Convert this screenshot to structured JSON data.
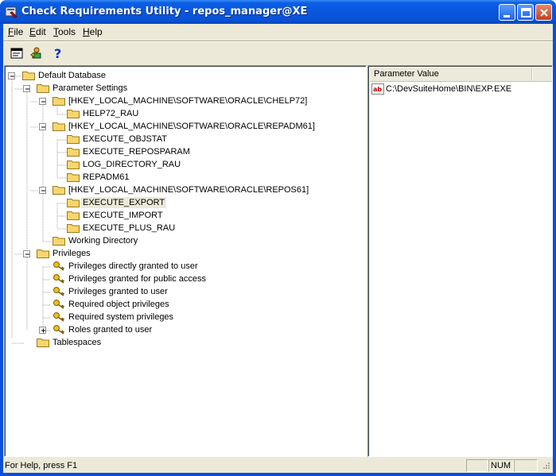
{
  "window": {
    "title": "Check Requirements Utility - repos_manager@XE"
  },
  "menu": {
    "items": [
      {
        "label": "File",
        "key": "F"
      },
      {
        "label": "Edit",
        "key": "E"
      },
      {
        "label": "Tools",
        "key": "T"
      },
      {
        "label": "Help",
        "key": "H"
      }
    ]
  },
  "toolbar": {
    "icons": [
      "properties-icon",
      "connect-icon",
      "help-icon"
    ]
  },
  "tree": {
    "root": "Default Database",
    "parameter_settings": "Parameter Settings",
    "chelp72_key": "[HKEY_LOCAL_MACHINE\\SOFTWARE\\ORACLE\\CHELP72]",
    "help72_rau": "HELP72_RAU",
    "repadm61_key": "[HKEY_LOCAL_MACHINE\\SOFTWARE\\ORACLE\\REPADM61]",
    "execute_objstat": "EXECUTE_OBJSTAT",
    "execute_reposparam": "EXECUTE_REPOSPARAM",
    "log_directory_rau": "LOG_DIRECTORY_RAU",
    "repadm61": "REPADM61",
    "repos61_key": "[HKEY_LOCAL_MACHINE\\SOFTWARE\\ORACLE\\REPOS61]",
    "execute_export": "EXECUTE_EXPORT",
    "execute_import": "EXECUTE_IMPORT",
    "execute_plus_rau": "EXECUTE_PLUS_RAU",
    "working_directory": "Working Directory",
    "privileges": "Privileges",
    "priv_direct": "Privileges directly granted to user",
    "priv_public": "Privileges granted for public access",
    "priv_user": "Privileges granted to user",
    "priv_object": "Required object privileges",
    "priv_system": "Required system privileges",
    "roles": "Roles granted to user",
    "tablespaces": "Tablespaces"
  },
  "list": {
    "column_header": "Parameter Value",
    "values": [
      "C:\\DevSuiteHome\\BIN\\EXP.EXE"
    ]
  },
  "status": {
    "help_text": "For Help, press F1",
    "num": "NUM"
  },
  "colors": {
    "title_blue": "#0a55dd",
    "folder_yellow": "#f8d66b",
    "key_yellow": "#e8c020"
  }
}
